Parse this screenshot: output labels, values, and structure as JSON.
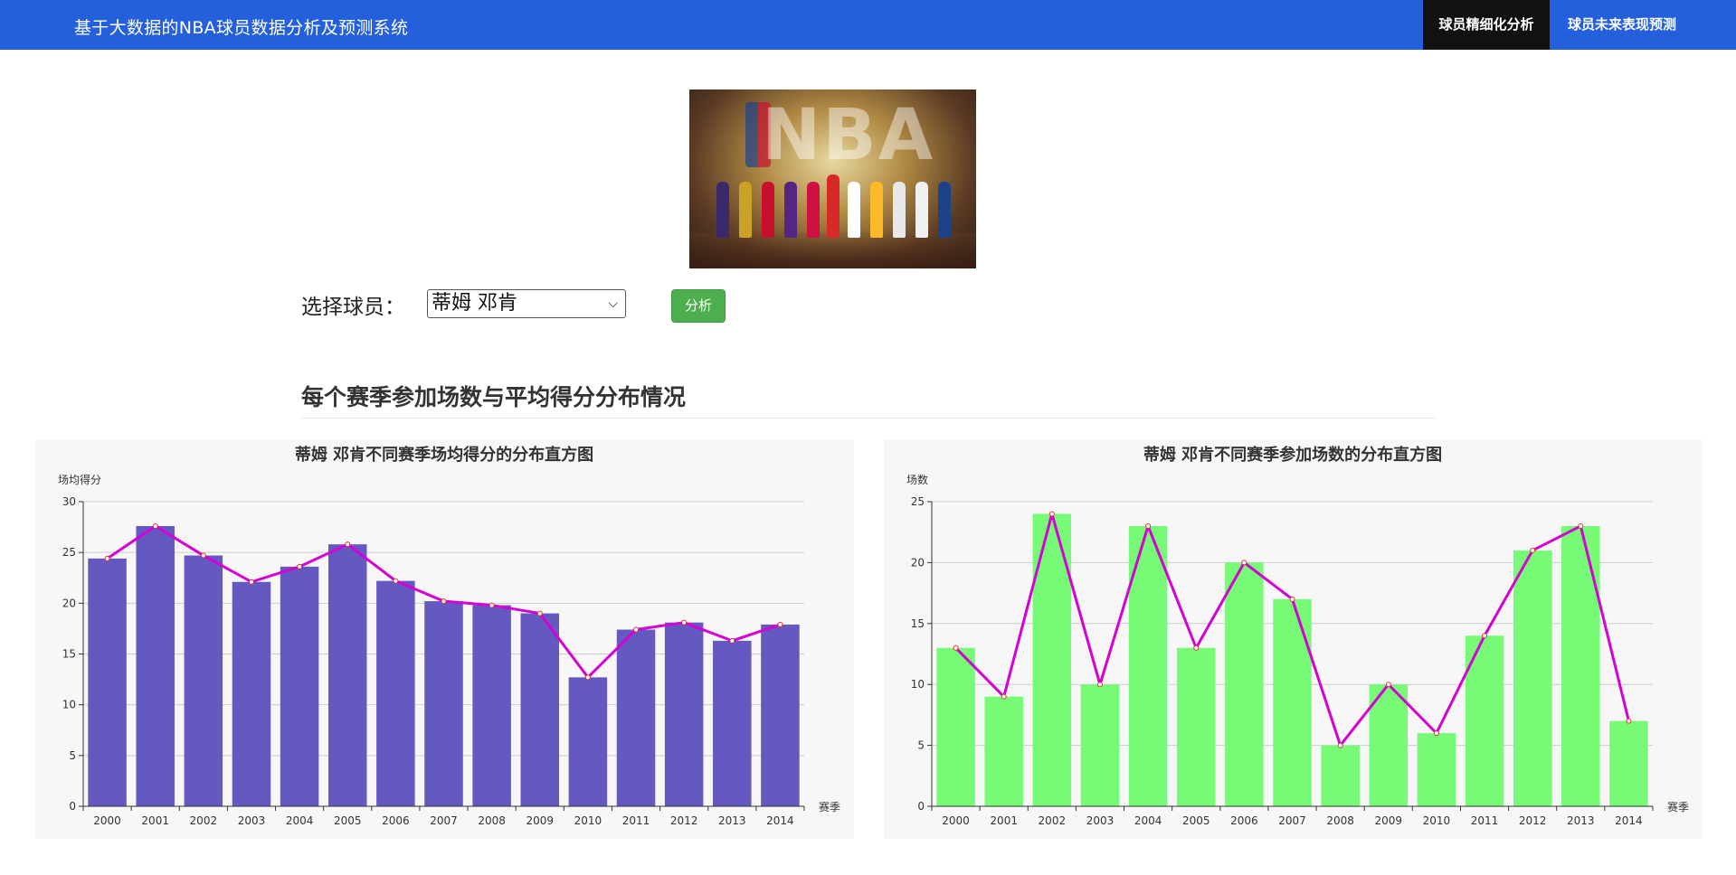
{
  "header": {
    "title": "基于大数据的NBA球员数据分析及预测系统",
    "nav": [
      {
        "label": "球员精细化分析",
        "active": true
      },
      {
        "label": "球员未来表现预测",
        "active": false
      }
    ]
  },
  "form": {
    "select_label": "选择球员：",
    "selected_player": "蒂姆 邓肯",
    "analyze_label": "分析"
  },
  "section": {
    "title": "每个赛季参加场数与平均得分分布情况"
  },
  "chart_data": [
    {
      "type": "bar",
      "title": "蒂姆 邓肯不同赛季场均得分的分布直方图",
      "ylabel": "场均得分",
      "xlabel": "赛季",
      "categories": [
        "2000",
        "2001",
        "2002",
        "2003",
        "2004",
        "2005",
        "2006",
        "2007",
        "2008",
        "2009",
        "2010",
        "2011",
        "2012",
        "2013",
        "2014"
      ],
      "values": [
        24.4,
        27.6,
        24.7,
        22.1,
        23.6,
        25.8,
        22.2,
        20.2,
        19.8,
        19.0,
        12.7,
        17.4,
        18.1,
        16.3,
        17.9
      ],
      "ylim": [
        0,
        30
      ],
      "yticks": [
        0,
        5,
        10,
        15,
        20,
        25,
        30
      ],
      "grid": true,
      "bar_color": "#6359c0",
      "line_color": "#d400d4"
    },
    {
      "type": "bar",
      "title": "蒂姆 邓肯不同赛季参加场数的分布直方图",
      "ylabel": "场数",
      "xlabel": "赛季",
      "categories": [
        "2000",
        "2001",
        "2002",
        "2003",
        "2004",
        "2005",
        "2006",
        "2007",
        "2008",
        "2009",
        "2010",
        "2011",
        "2012",
        "2013",
        "2014"
      ],
      "values": [
        13,
        9,
        24,
        10,
        23,
        13,
        20,
        17,
        5,
        10,
        6,
        14,
        21,
        23,
        7
      ],
      "ylim": [
        0,
        25
      ],
      "yticks": [
        0,
        5,
        10,
        15,
        20,
        25
      ],
      "grid": true,
      "bar_color": "#77fb77",
      "line_color": "#d400d4"
    }
  ]
}
